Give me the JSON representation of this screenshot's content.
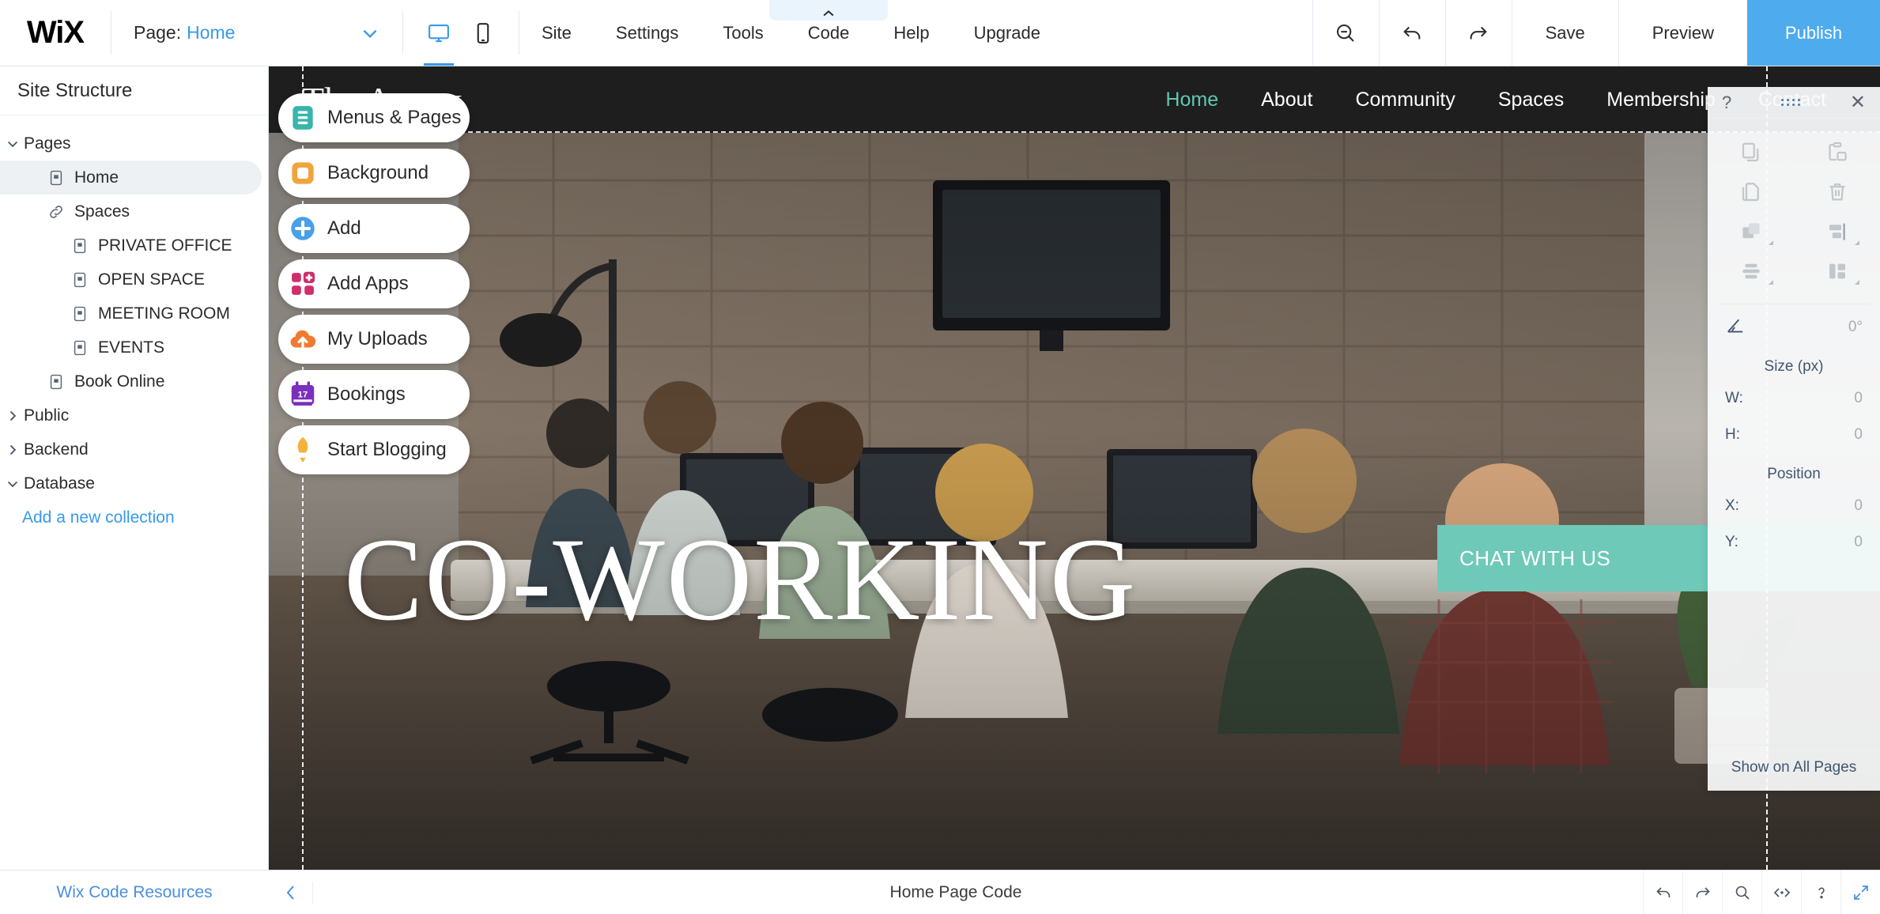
{
  "topbar": {
    "logo": "WiX",
    "page_label": "Page:",
    "page_value": "Home",
    "chevron_icon": "chevron-down-icon",
    "desktop_icon": "desktop-icon",
    "mobile_icon": "mobile-icon",
    "menu": [
      {
        "label": "Site"
      },
      {
        "label": "Settings"
      },
      {
        "label": "Tools"
      },
      {
        "label": "Code",
        "tab_active": true,
        "tab_icon": "chevron-up-icon"
      },
      {
        "label": "Help"
      },
      {
        "label": "Upgrade"
      }
    ],
    "zoom_out_icon": "zoom-out-icon",
    "undo_icon": "undo-icon",
    "redo_icon": "redo-icon",
    "save_label": "Save",
    "preview_label": "Preview",
    "publish_label": "Publish",
    "publish_color": "#4eabee"
  },
  "sidebar": {
    "title": "Site Structure",
    "tree": [
      {
        "label": "Pages",
        "level": 0,
        "chevron": "chevron-down-icon",
        "icon": "",
        "selected": false
      },
      {
        "label": "Home",
        "level": 1,
        "chevron": "",
        "icon": "page-icon",
        "selected": true
      },
      {
        "label": "Spaces",
        "level": 1,
        "chevron": "",
        "icon": "link-icon",
        "selected": false
      },
      {
        "label": "PRIVATE OFFICE",
        "level": 2,
        "chevron": "",
        "icon": "page-icon",
        "selected": false
      },
      {
        "label": "OPEN SPACE",
        "level": 2,
        "chevron": "",
        "icon": "page-icon",
        "selected": false
      },
      {
        "label": "MEETING ROOM",
        "level": 2,
        "chevron": "",
        "icon": "page-icon",
        "selected": false
      },
      {
        "label": "EVENTS",
        "level": 2,
        "chevron": "",
        "icon": "page-icon",
        "selected": false
      },
      {
        "label": "Book Online",
        "level": 1,
        "chevron": "",
        "icon": "page-icon",
        "selected": false
      },
      {
        "label": "Public",
        "level": 0,
        "chevron": "chevron-right-icon",
        "icon": "",
        "selected": false
      },
      {
        "label": "Backend",
        "level": 0,
        "chevron": "chevron-right-icon",
        "icon": "",
        "selected": false
      },
      {
        "label": "Database",
        "level": 0,
        "chevron": "chevron-down-icon",
        "icon": "",
        "selected": false
      }
    ],
    "add_collection_label": "Add a new collection",
    "footer_link": "Wix Code Resources"
  },
  "tools": [
    {
      "label": "Menus & Pages",
      "icon": "menus-pages-icon",
      "color": "#39b5ac"
    },
    {
      "label": "Background",
      "icon": "background-icon",
      "color": "#f0a43c"
    },
    {
      "label": "Add",
      "icon": "add-icon",
      "color": "#4a9fe8"
    },
    {
      "label": "Add Apps",
      "icon": "add-apps-icon",
      "color": "#ce2e6c"
    },
    {
      "label": "My Uploads",
      "icon": "upload-icon",
      "color": "#ef7b30"
    },
    {
      "label": "Bookings",
      "icon": "bookings-icon",
      "color": "#7b2fbd"
    },
    {
      "label": "Start Blogging",
      "icon": "blogging-icon",
      "color": "#f2b33d"
    }
  ],
  "site": {
    "logo": "The Annex",
    "nav": [
      {
        "label": "Home",
        "active": true
      },
      {
        "label": "About",
        "active": false
      },
      {
        "label": "Community",
        "active": false
      },
      {
        "label": "Spaces",
        "active": false
      },
      {
        "label": "Membership",
        "active": false
      },
      {
        "label": "Contact",
        "active": false
      }
    ],
    "hero_title": "CO-WORKING",
    "chat_banner": "CHAT WITH US",
    "chat_banner_color": "#6ec9b8",
    "active_nav_color": "#5ec8b0"
  },
  "props": {
    "help_icon": "question-mark-icon",
    "drag_icon": "drag-dots-icon",
    "close_icon": "close-icon",
    "actions": [
      {
        "icon": "copy-icon"
      },
      {
        "icon": "paste-icon"
      },
      {
        "icon": "duplicate-icon"
      },
      {
        "icon": "trash-icon"
      },
      {
        "icon": "arrange-icon"
      },
      {
        "icon": "align-icon"
      },
      {
        "icon": "distribute-icon"
      },
      {
        "icon": "match-size-icon"
      }
    ],
    "angle_icon": "angle-icon",
    "angle_value": "0°",
    "size_title": "Size (px)",
    "size_fields": [
      {
        "label": "W:",
        "value": "0"
      },
      {
        "label": "H:",
        "value": "0"
      }
    ],
    "position_title": "Position",
    "position_fields": [
      {
        "label": "X:",
        "value": "0"
      },
      {
        "label": "Y:",
        "value": "0"
      }
    ],
    "show_all_pages": "Show on All Pages"
  },
  "codebar": {
    "collapse_icon": "chevron-left-icon",
    "title": "Home Page Code",
    "icons": [
      {
        "icon": "undo-icon"
      },
      {
        "icon": "redo-icon"
      },
      {
        "icon": "search-icon"
      },
      {
        "icon": "code-format-icon"
      },
      {
        "icon": "question-mark-icon"
      },
      {
        "icon": "expand-icon"
      }
    ]
  }
}
